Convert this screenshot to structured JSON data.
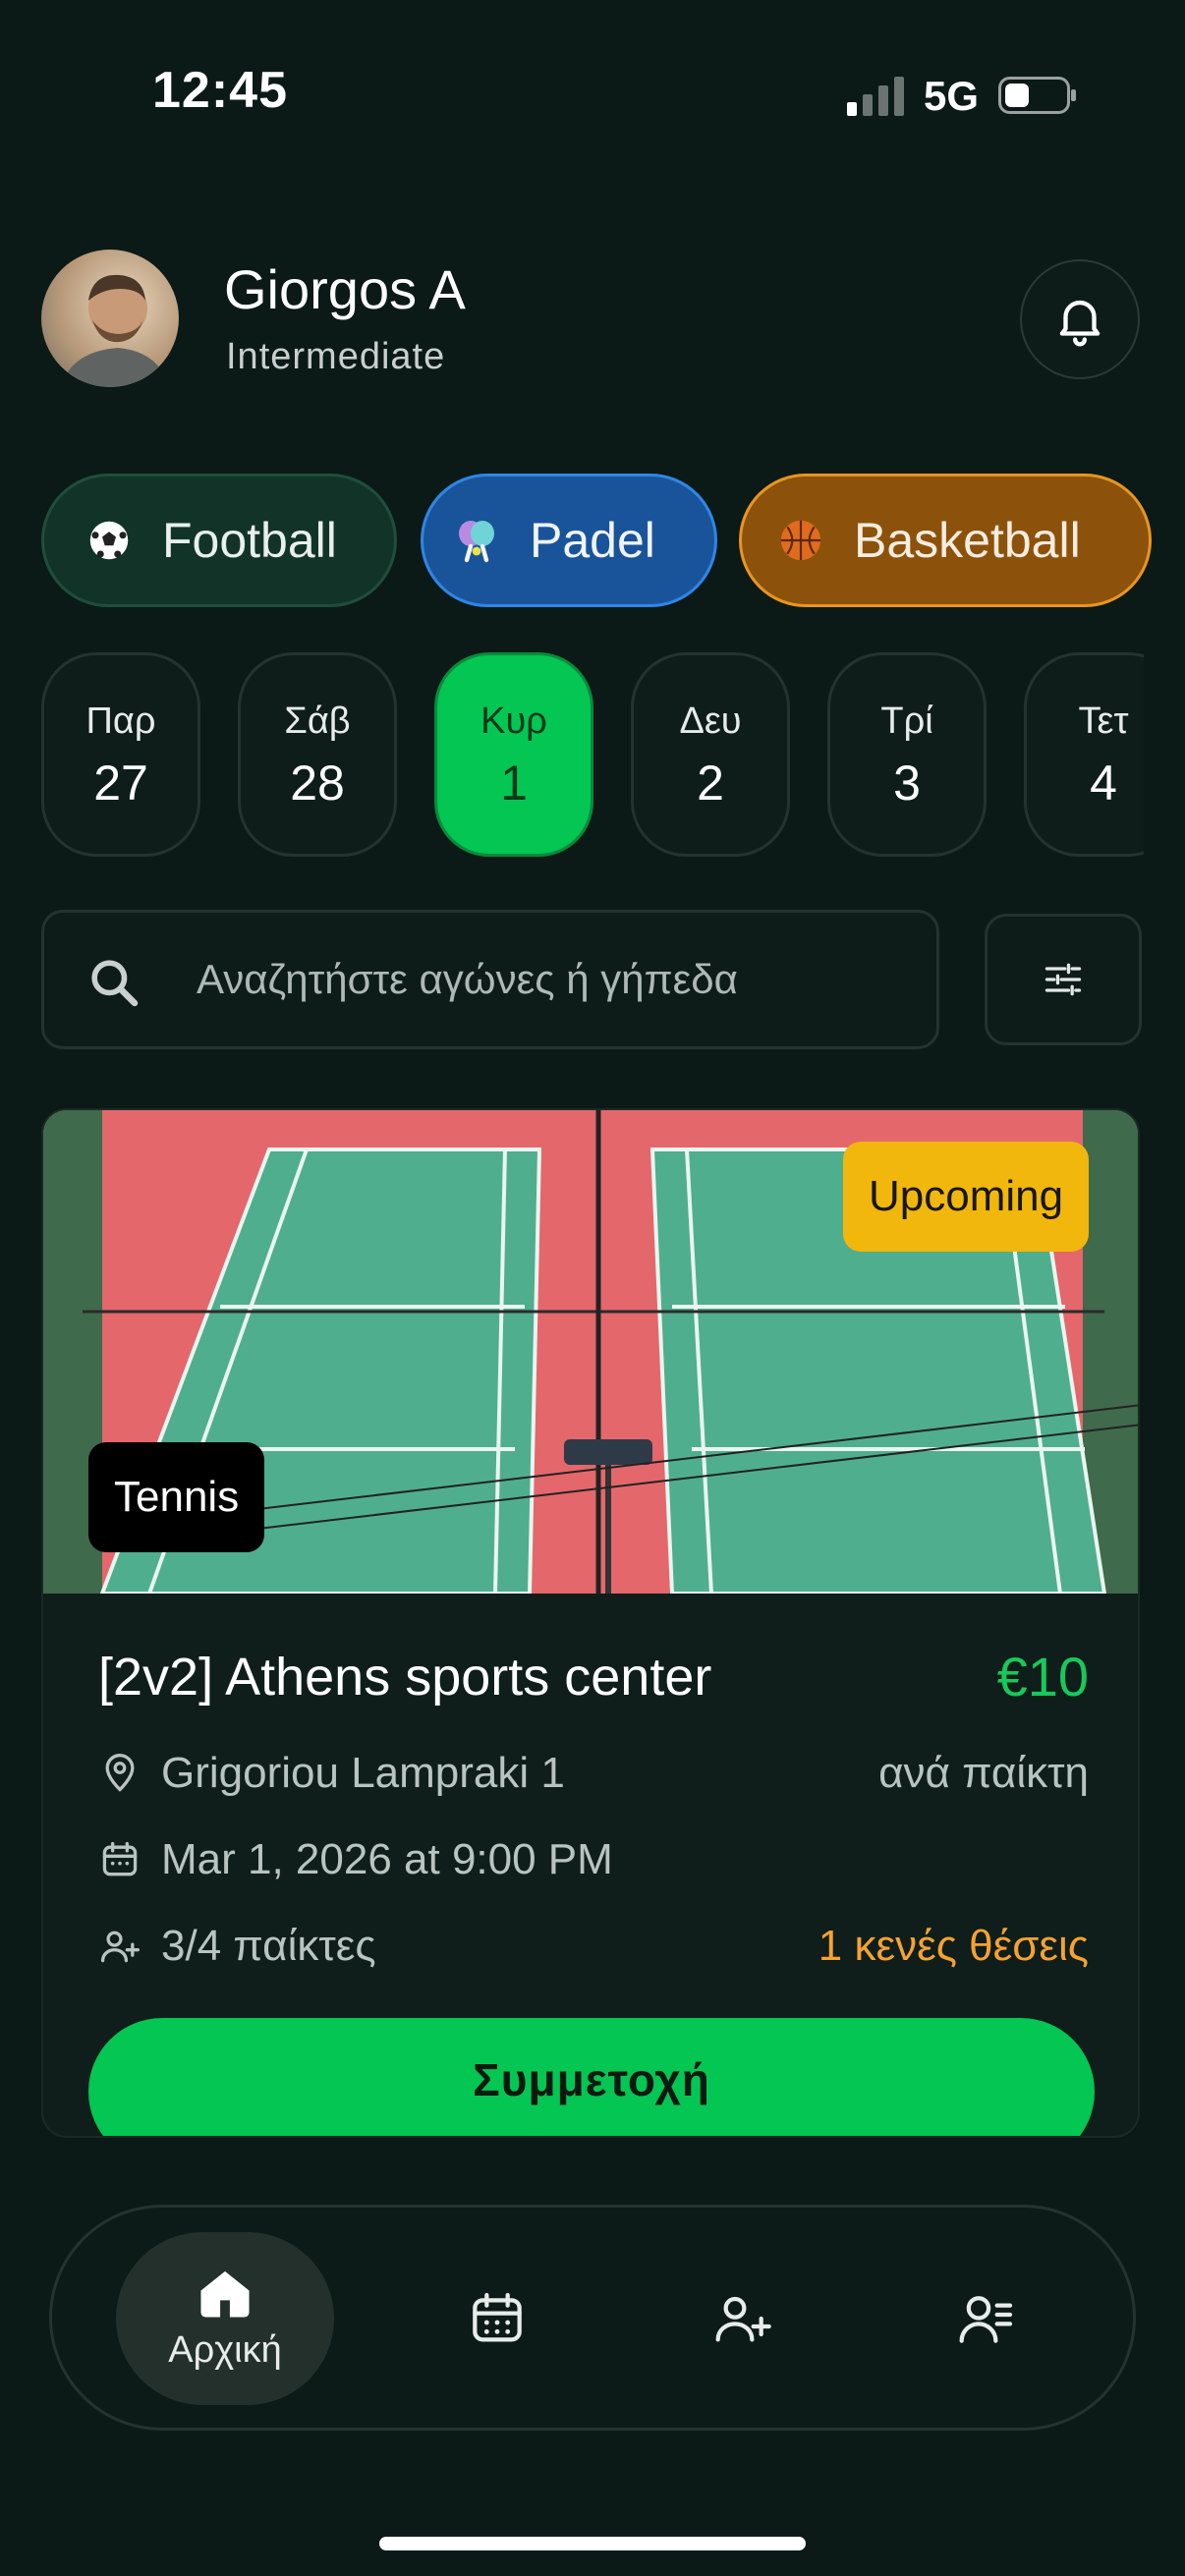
{
  "status_bar": {
    "time": "12:45",
    "network": "5G"
  },
  "profile": {
    "name": "Giorgos A",
    "level": "Intermediate"
  },
  "sports": [
    {
      "label": "Football",
      "icon": "soccer-ball-icon"
    },
    {
      "label": "Padel",
      "icon": "padel-racket-icon"
    },
    {
      "label": "Basketball",
      "icon": "basketball-icon"
    }
  ],
  "dates": [
    {
      "day": "Παρ",
      "num": "27"
    },
    {
      "day": "Σάβ",
      "num": "28"
    },
    {
      "day": "Κυρ",
      "num": "1",
      "selected": true
    },
    {
      "day": "Δευ",
      "num": "2"
    },
    {
      "day": "Τρί",
      "num": "3"
    },
    {
      "day": "Τετ",
      "num": "4"
    }
  ],
  "search": {
    "placeholder": "Αναζητήστε αγώνες ή γήπεδα"
  },
  "match": {
    "status_badge": "Upcoming",
    "sport_badge": "Tennis",
    "title": "[2v2] Athens sports center",
    "price": "€10",
    "price_unit": "ανά παίκτη",
    "location": "Grigoriou Lampraki 1",
    "datetime": "Mar 1, 2026 at 9:00 PM",
    "players": "3/4 παίκτες",
    "open_spots": "1 κενές θέσεις",
    "join_label": "Συμμετοχή"
  },
  "nav": {
    "home_label": "Αρχική"
  },
  "colors": {
    "accent": "#04c653",
    "background": "#0b1a16",
    "upcoming": "#f2b70c",
    "spots": "#f5a232"
  }
}
